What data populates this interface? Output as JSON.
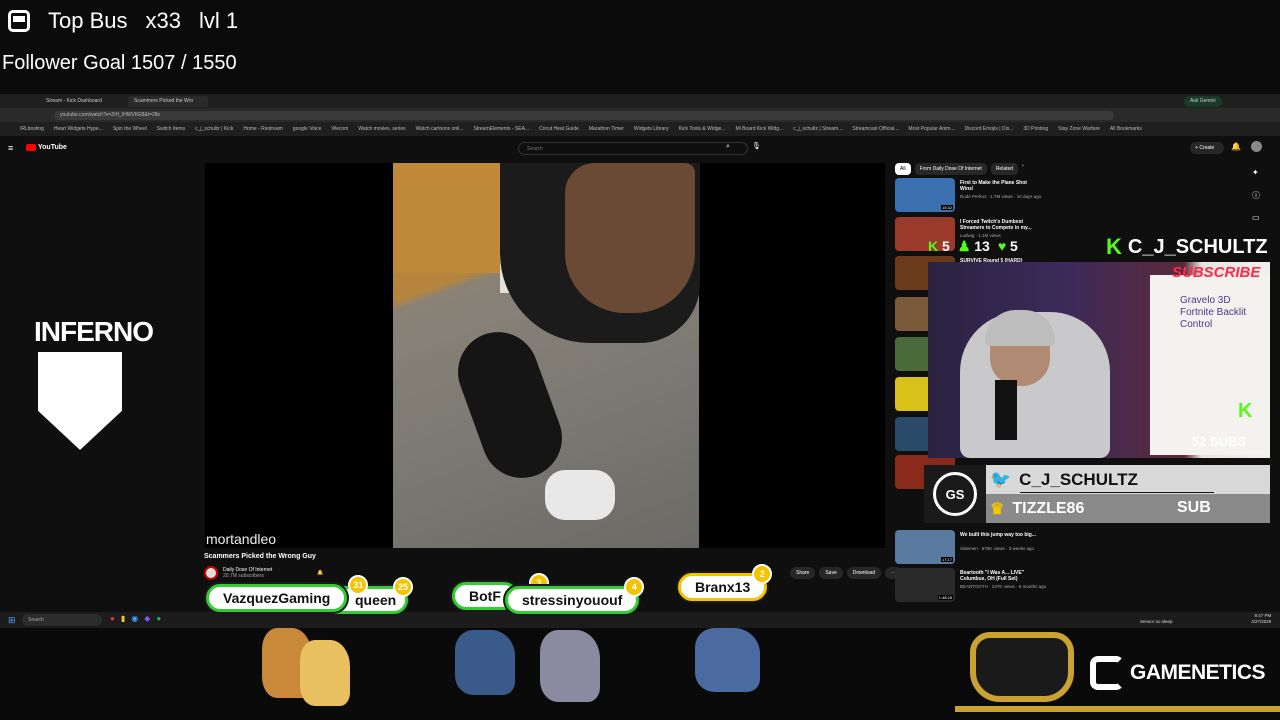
{
  "overlay": {
    "top_bus_label": "Top Bus",
    "top_bus_count": "x33",
    "top_bus_level": "lvl 1",
    "follower_goal": "Follower Goal 1507 / 1550"
  },
  "browser": {
    "tabs": [
      {
        "label": "Stream - Kick Dashboard"
      },
      {
        "label": "Scammers Picked the Wro"
      }
    ],
    "url": "youtube.com/watch?v=ZiH_IHWVKE8&t=28s",
    "bookmarks": [
      "IRLbosting",
      "Heart Widgets Hype...",
      "Spin the Wheel",
      "Switch Items",
      "c_j_schultz | Kick",
      "Home - Restream",
      "google Voice",
      "Wecom",
      "Watch movies, series",
      "Watch cartoons onli...",
      "StreamElements - SEA...",
      "Cricut Heat Guide",
      "Marathon Timer",
      "Widgets Library",
      "Kick Tools & Widge...",
      "Mi Board Kick Widg...",
      "c_j_schultz | Stream...",
      "Streamcast Official...",
      "Most Popular Anim...",
      "Discord Emojis | Dis...",
      "3D Printing",
      "Stay Zone Warfare",
      "All Bookmarks"
    ],
    "ask_gemini": "Ask Gemini"
  },
  "youtube": {
    "logo": "YouTube",
    "search_placeholder": "Search",
    "create_label": "Create",
    "video_watermark": "mortandleo",
    "video_title": "Scammers Picked the Wrong Guy",
    "channel_name": "Daily Dose Of Internet",
    "channel_subs": "20.7M subscribers",
    "actions": [
      "Share",
      "Save",
      "Download"
    ],
    "chips": [
      "All",
      "From Daily Dose Of Internet",
      "Related"
    ],
    "recommendations": [
      {
        "title": "First to Make the Plane Shot Wins!",
        "meta": "Dude Perfect · 1.7M views · 10 days ago",
        "color": "#3a6fb0"
      },
      {
        "title": "I Forced Twitch's Dumbest Streamers to Compete in my...",
        "meta": "Ludwig · 1.1M views",
        "color": "#9a3a2a"
      },
      {
        "title": "SURVIVE Round 5 (HARD)",
        "meta": "",
        "color": "#6a3a1a"
      },
      {
        "title": "",
        "meta": "",
        "color": "#7a5a3a"
      },
      {
        "title": "",
        "meta": "",
        "color": "#4a6a3a"
      },
      {
        "title": "",
        "meta": "",
        "color": "#d8c21a"
      },
      {
        "title": "",
        "meta": "",
        "color": "#2a4a6a"
      },
      {
        "title": "",
        "meta": "",
        "color": "#8a2a1a"
      },
      {
        "title": "We built this jump way too big...",
        "meta": "Sidemen · 576K views · 3 weeks ago",
        "color": "#5a7aa0"
      },
      {
        "title": "Beartooth \"I Was A... LIVE\" Columbus, OH (Full Set)",
        "meta": "BEARTOOTH · 237K views · 5 months ago",
        "color": "#2a2a2a"
      }
    ],
    "rec_durations": [
      "15:32",
      "",
      "",
      "",
      "",
      "",
      "",
      "",
      "17:17",
      "1:48:28"
    ]
  },
  "stream": {
    "kick_stats": [
      {
        "icon": "kick",
        "value": "5"
      },
      {
        "icon": "person",
        "value": "13"
      },
      {
        "icon": "heart",
        "value": "5"
      }
    ],
    "kick_handle": "C_J_SCHULTZ",
    "subscribe_text": "SUBSCRIBE",
    "subs_count": "52 SUBS",
    "whiteboard_text": "Gravelo 3D Fortnite Backlit Control",
    "banner_logo": "GS",
    "twitter_handle": "C_J_SCHULTZ",
    "latest_sub": "TIZZLE86",
    "sub_label": "SUB",
    "team_logo": "INFERNO",
    "brand": "GAMENETICS",
    "colors": {
      "kick_green": "#53fc18",
      "twitter_blue": "#1d9bf0",
      "crown_gold": "#f5c400",
      "accent_gold": "#c9a233"
    }
  },
  "chat_badges": [
    {
      "name": "VazquezGaming",
      "level": "31"
    },
    {
      "name": "queen",
      "level": "25"
    },
    {
      "name": "BotF",
      "level": "3"
    },
    {
      "name": "stressinyououf",
      "level": "4"
    },
    {
      "name": "Branx13",
      "level": "2"
    }
  ],
  "taskbar": {
    "search_placeholder": "Search",
    "notification": "Sensor no sleep",
    "time": "9:47 PM",
    "date": "4/27/2025"
  }
}
